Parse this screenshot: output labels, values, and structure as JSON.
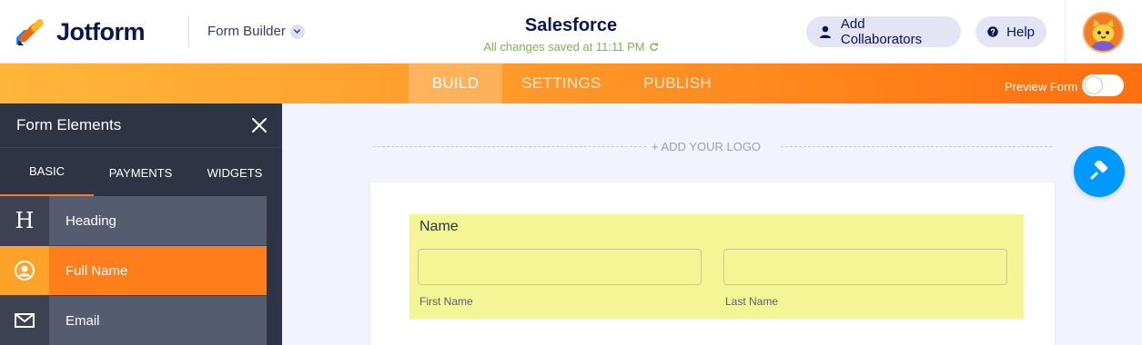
{
  "header": {
    "brand": "Jotform",
    "builder_label": "Form Builder",
    "form_title": "Salesforce",
    "save_status": "All changes saved at 11:11 PM",
    "collab_label": "Add Collaborators",
    "help_label": "Help"
  },
  "nav": {
    "tabs": [
      {
        "label": "BUILD",
        "active": true
      },
      {
        "label": "SETTINGS",
        "active": false
      },
      {
        "label": "PUBLISH",
        "active": false
      }
    ],
    "preview_label": "Preview Form",
    "preview_on": false
  },
  "sidebar": {
    "title": "Form Elements",
    "tabs": [
      {
        "label": "BASIC",
        "active": true
      },
      {
        "label": "PAYMENTS",
        "active": false
      },
      {
        "label": "WIDGETS",
        "active": false
      }
    ],
    "items": [
      {
        "label": "Heading",
        "icon": "heading-icon"
      },
      {
        "label": "Full Name",
        "icon": "user-icon",
        "selected": true
      },
      {
        "label": "Email",
        "icon": "envelope-icon"
      }
    ]
  },
  "canvas": {
    "add_logo": "+ ADD YOUR LOGO",
    "field": {
      "label": "Name",
      "first_value": "",
      "last_value": "",
      "first_sub": "First Name",
      "last_sub": "Last Name"
    }
  },
  "colors": {
    "brand_navy": "#0a1551",
    "accent_orange": "#ff7d1a",
    "saved_green": "#7ab845",
    "field_highlight": "#f4f696",
    "paint_blue": "#0099ff"
  }
}
